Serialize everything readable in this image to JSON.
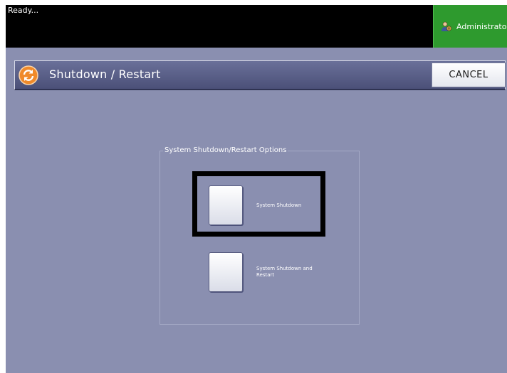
{
  "status": {
    "text": "Ready..."
  },
  "admin": {
    "label": "Administrator",
    "icon": "user-admin-icon",
    "color": "#2e9a2e"
  },
  "dialog": {
    "title": "Shutdown / Restart",
    "title_icon": "refresh-icon",
    "cancel_label": "CANCEL"
  },
  "options": {
    "group_label": "System Shutdown/Restart Options",
    "items": [
      {
        "label": "System Shutdown",
        "highlighted": true
      },
      {
        "label": "System Shutdown and Restart",
        "highlighted": false
      }
    ]
  },
  "colors": {
    "background": "#8a8fb0",
    "title_bar": "#5a608a",
    "highlight": "#000000"
  }
}
